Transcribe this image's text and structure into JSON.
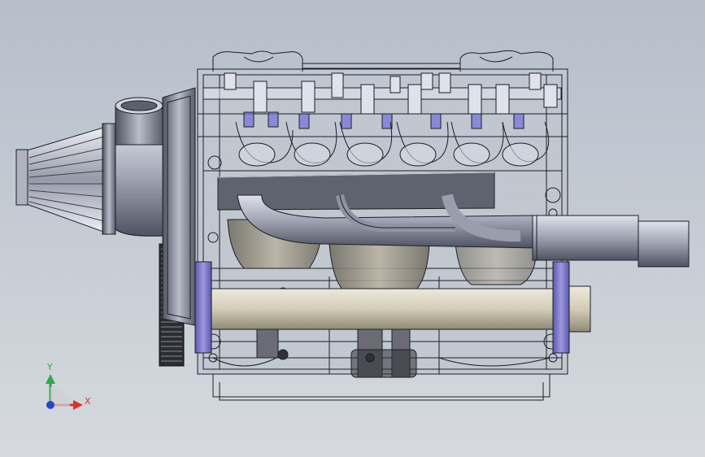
{
  "viewport": {
    "background_top": "#b6bfc9",
    "background_bottom": "#d6dadf",
    "model_colors": {
      "edge": "#1b1f26",
      "metal_light": "#d4d8e0",
      "metal_mid": "#9ea3b2",
      "metal_dark": "#4a4e5c",
      "sleeve": "#d9d4c0",
      "bearing_cap": "#7a76c6",
      "valve_blue": "#5a5ad6"
    }
  },
  "triad": {
    "y_label": "Y",
    "x_label": "X",
    "y_color": "#2fa84f",
    "x_color": "#d9342b",
    "z_color": "#2a44c8"
  }
}
